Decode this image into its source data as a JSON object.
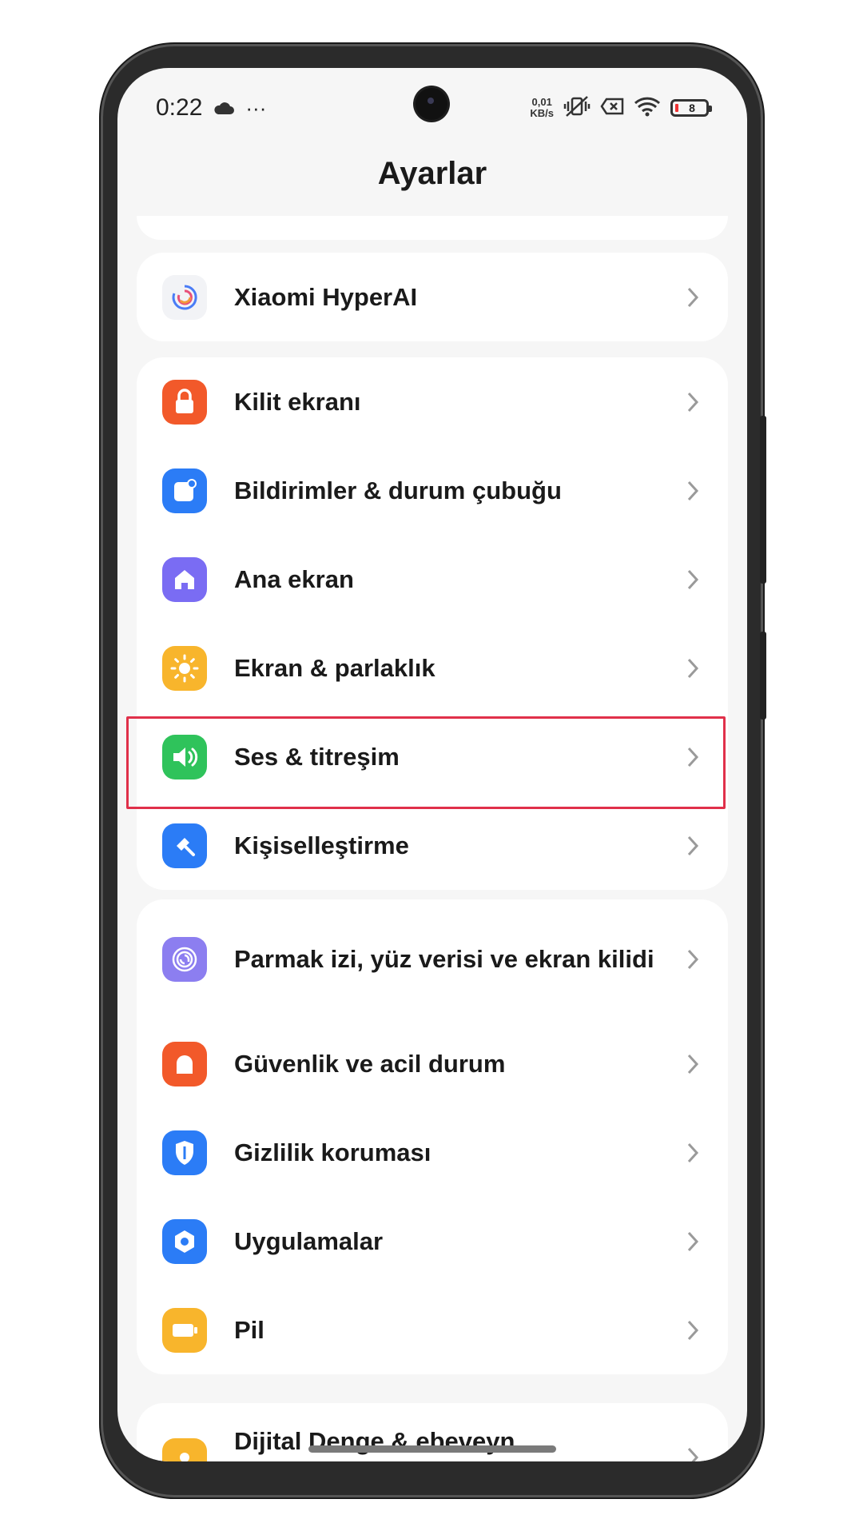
{
  "status": {
    "time": "0:22",
    "network_speed": "0,01\nKB/s",
    "battery_level": "8"
  },
  "header": {
    "title": "Ayarlar"
  },
  "groups": [
    {
      "items": [
        {
          "label": "Xiaomi HyperAI",
          "icon": "hyperai-swirl-icon"
        }
      ]
    },
    {
      "items": [
        {
          "label": "Kilit ekranı",
          "icon": "lock-icon",
          "color": "#f2592a"
        },
        {
          "label": "Bildirimler & durum çubuğu",
          "icon": "notification-icon",
          "color": "#2b7cf6"
        },
        {
          "label": "Ana ekran",
          "icon": "home-icon",
          "color": "#7a6cf3"
        },
        {
          "label": "Ekran & parlaklık",
          "icon": "sun-icon",
          "color": "#f8b52c"
        },
        {
          "label": "Ses & titreşim",
          "icon": "speaker-icon",
          "color": "#2fc35b"
        },
        {
          "label": "Kişiselleştirme",
          "icon": "brush-icon",
          "color": "#2b7cf6"
        }
      ]
    },
    {
      "items": [
        {
          "label": "Parmak izi, yüz verisi ve ekran kilidi",
          "icon": "fingerprint-icon",
          "color": "#8c7ef0"
        },
        {
          "label": "Güvenlik ve acil durum",
          "icon": "alert-icon",
          "color": "#f2592a"
        },
        {
          "label": "Gizlilik koruması",
          "icon": "privacy-shield-icon",
          "color": "#2b7cf6"
        },
        {
          "label": "Uygulamalar",
          "icon": "apps-hexagon-icon",
          "color": "#2b7cf6"
        },
        {
          "label": "Pil",
          "icon": "battery-icon",
          "color": "#f8b52c"
        }
      ]
    },
    {
      "items": [
        {
          "label": "Dijital Denge & ebeveyn",
          "icon": "digital-balance-icon",
          "color": "#f8b52c"
        }
      ]
    }
  ],
  "highlighted_item": "Ses & titreşim"
}
